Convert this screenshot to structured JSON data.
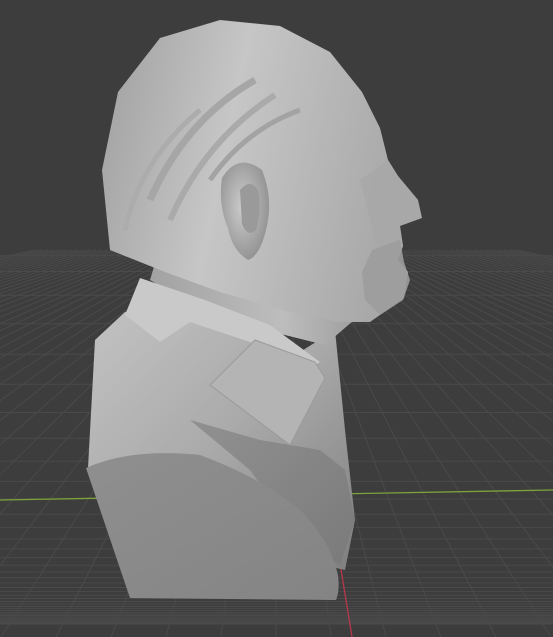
{
  "viewport": {
    "background_color": "#3d3d3d",
    "grid_color": "#4a4a4a",
    "x_axis_color": "#7da33a",
    "z_axis_color": "#b8384a",
    "model_color": "#b9b9b9"
  },
  "icons": {
    "model": "sculpt-bust",
    "grid": "floor-grid",
    "axes": "axis-lines"
  }
}
